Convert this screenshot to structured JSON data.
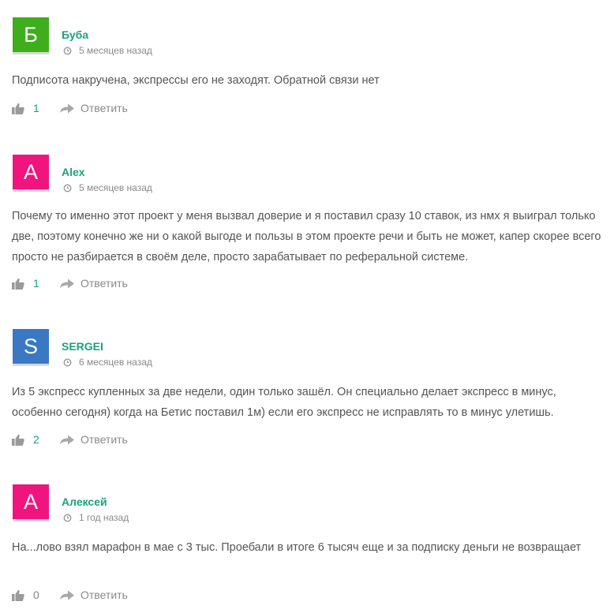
{
  "comments": [
    {
      "avatar_letter": "Б",
      "avatar_color": "#3fae1c",
      "author": "Буба",
      "date": "5 месяцев назад",
      "text": "Подписота накручена, экспрессы его не заходят. Обратной связи нет",
      "likes": "1",
      "reply_label": "Ответить"
    },
    {
      "avatar_letter": "A",
      "avatar_color": "#f0147f",
      "author": "Alex",
      "date": "5 месяцев назад",
      "text": "Почему то именно этот проект у меня вызвал доверие и я поставил сразу 10 ставок, из нмх я выиграл только две, поэтому конечно же ни о какой выгоде и пользы в этом проекте речи и быть не может, капер скорее всего просто не разбирается в своём деле, просто зарабатывает по реферальной системе.",
      "likes": "1",
      "reply_label": "Ответить"
    },
    {
      "avatar_letter": "S",
      "avatar_color": "#3a78c3",
      "author": "SERGEI",
      "date": "6 месяцев назад",
      "text": "Из 5 экспресс купленных за две недели, один только зашёл. Он специально делает экспресс в минус, особенно сегодня) когда на Бетис поставил 1м) если его экспресс не исправлять то в минус улетишь.",
      "likes": "2",
      "reply_label": "Ответить"
    },
    {
      "avatar_letter": "А",
      "avatar_color": "#f0147f",
      "author": "Алексей",
      "date": "1 год назад",
      "text": "На...лово взял марафон в мае с 3 тыс. Проебали в итоге 6 тысяч еще и за подписку деньги не возвращает",
      "likes": "0",
      "reply_label": "Ответить"
    }
  ],
  "icons": {
    "clock": "clock-icon",
    "like": "thumbs-up-icon",
    "reply": "reply-arrow-icon"
  }
}
